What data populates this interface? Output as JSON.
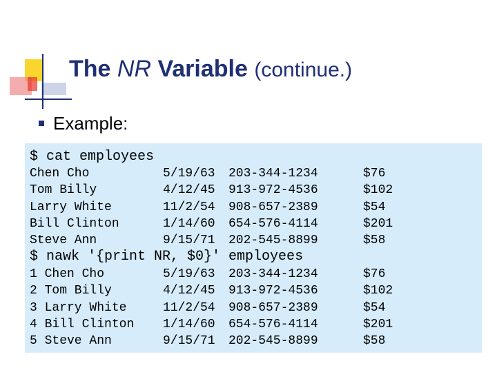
{
  "slide": {
    "title_bold": "The",
    "title_italic": "NR",
    "title_bold2": "Variable",
    "title_rest": "(continue.)",
    "bullet_text": "Example:"
  },
  "code": {
    "cmd1": "$ cat employees",
    "rows1": [
      {
        "name": "Chen Cho",
        "date": "5/19/63",
        "phone": "203-344-1234",
        "amount": "$76"
      },
      {
        "name": "Tom Billy",
        "date": "4/12/45",
        "phone": "913-972-4536",
        "amount": "$102"
      },
      {
        "name": "Larry White",
        "date": "11/2/54",
        "phone": "908-657-2389",
        "amount": "$54"
      },
      {
        "name": "Bill Clinton",
        "date": "1/14/60",
        "phone": "654-576-4114",
        "amount": "$201"
      },
      {
        "name": "Steve Ann",
        "date": "9/15/71",
        "phone": "202-545-8899",
        "amount": "$58"
      }
    ],
    "cmd2": "$ nawk '{print NR, $0}' employees",
    "rows2": [
      {
        "name": "1 Chen Cho",
        "date": "5/19/63",
        "phone": "203-344-1234",
        "amount": "$76"
      },
      {
        "name": "2 Tom Billy",
        "date": "4/12/45",
        "phone": "913-972-4536",
        "amount": "$102"
      },
      {
        "name": "3 Larry White",
        "date": "11/2/54",
        "phone": "908-657-2389",
        "amount": "$54"
      },
      {
        "name": "4 Bill Clinton",
        "date": "1/14/60",
        "phone": "654-576-4114",
        "amount": "$201"
      },
      {
        "name": "5 Steve Ann",
        "date": "9/15/71",
        "phone": "202-545-8899",
        "amount": "$58"
      }
    ]
  },
  "colors": {
    "title": "#1f2f73",
    "code_background": "#d6ecfb",
    "deco_yellow": "#f7d117",
    "deco_red": "#e8342b",
    "deco_blue": "#4a64b0"
  }
}
